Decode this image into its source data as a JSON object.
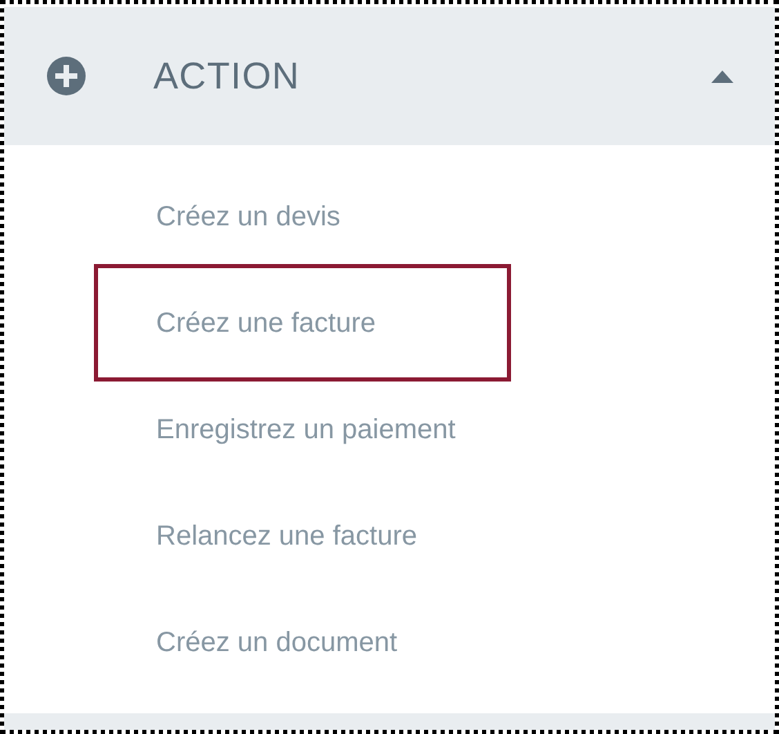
{
  "section": {
    "title": "ACTION",
    "expanded": true
  },
  "items": [
    {
      "label": "Créez un devis",
      "selected": false
    },
    {
      "label": "Créez une facture",
      "selected": true
    },
    {
      "label": "Enregistrez un paiement",
      "selected": false
    },
    {
      "label": "Relancez une facture",
      "selected": false
    },
    {
      "label": "Créez un document",
      "selected": false
    }
  ]
}
